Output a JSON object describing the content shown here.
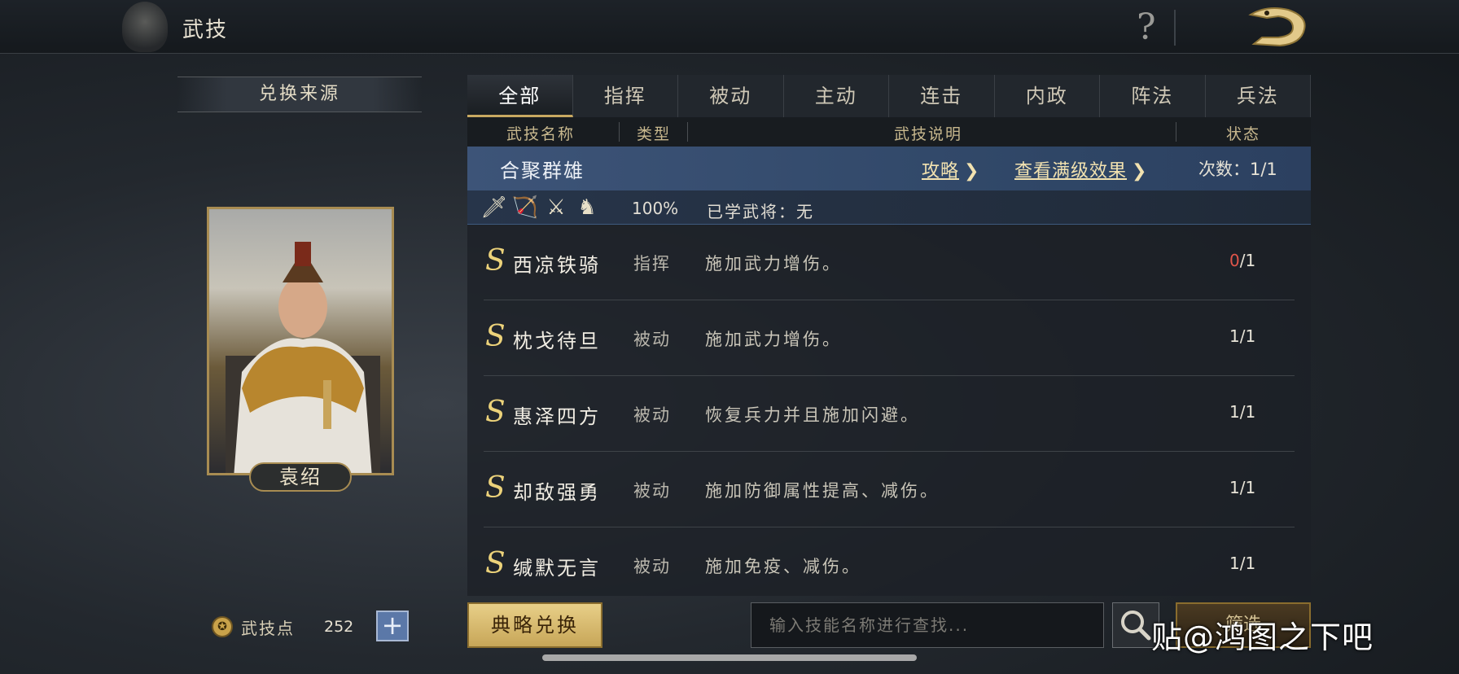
{
  "header": {
    "title": "武技",
    "help_icon": "?"
  },
  "left": {
    "source_title": "兑换来源",
    "general_name": "袁绍",
    "points_label": "武技点",
    "points_value": "252",
    "add_label": "+"
  },
  "tabs": [
    {
      "label": "全部",
      "active": true
    },
    {
      "label": "指挥",
      "active": false
    },
    {
      "label": "被动",
      "active": false
    },
    {
      "label": "主动",
      "active": false
    },
    {
      "label": "连击",
      "active": false
    },
    {
      "label": "内政",
      "active": false
    },
    {
      "label": "阵法",
      "active": false
    },
    {
      "label": "兵法",
      "active": false
    }
  ],
  "columns": {
    "name": "武技名称",
    "type": "类型",
    "desc": "武技说明",
    "status": "状态"
  },
  "group": {
    "name": "合聚群雄",
    "guide_link": "攻略",
    "max_effect_link": "查看满级效果",
    "count": "次数：1/1",
    "rate": "100%",
    "learned": "已学武将：无"
  },
  "skills": [
    {
      "grade": "S",
      "name": "西凉铁骑",
      "type": "指挥",
      "desc": "施加武力增伤。",
      "cur": "0",
      "max": "/1"
    },
    {
      "grade": "S",
      "name": "枕戈待旦",
      "type": "被动",
      "desc": "施加武力增伤。",
      "cur": "1",
      "max": "/1"
    },
    {
      "grade": "S",
      "name": "惠泽四方",
      "type": "被动",
      "desc": "恢复兵力并且施加闪避。",
      "cur": "1",
      "max": "/1"
    },
    {
      "grade": "S",
      "name": "却敌强勇",
      "type": "被动",
      "desc": "施加防御属性提高、减伤。",
      "cur": "1",
      "max": "/1"
    },
    {
      "grade": "S",
      "name": "缄默无言",
      "type": "被动",
      "desc": "施加免疫、减伤。",
      "cur": "1",
      "max": "/1"
    }
  ],
  "footer": {
    "exchange_label": "典略兑换",
    "search_placeholder": "输入技能名称进行查找...",
    "filter_label": "筛选"
  },
  "watermark": "贴@鸿图之下吧",
  "colors": {
    "accent_gold": "#c8a860",
    "zero_red": "#e0554a",
    "group_blue": "#3d5478"
  }
}
